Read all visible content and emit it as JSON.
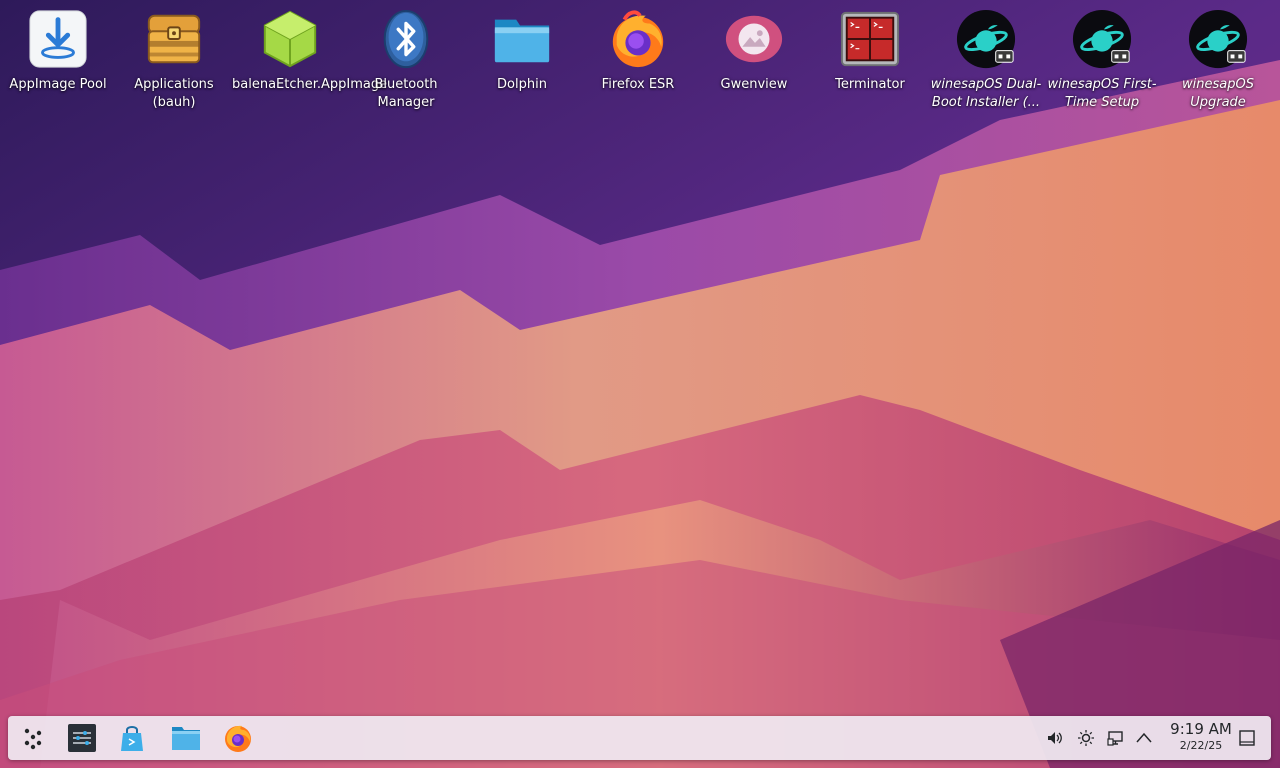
{
  "desktop": {
    "icons": [
      {
        "label": "AppImage Pool",
        "icon": "appimage-pool-icon"
      },
      {
        "label": "Applications (bauh)",
        "icon": "bauh-chest-icon"
      },
      {
        "label": "balenaEtcher.AppImage",
        "icon": "balena-etcher-icon"
      },
      {
        "label": "Bluetooth Manager",
        "icon": "bluetooth-icon"
      },
      {
        "label": "Dolphin",
        "icon": "folder-icon"
      },
      {
        "label": "Firefox ESR",
        "icon": "firefox-icon"
      },
      {
        "label": "Gwenview",
        "icon": "gwenview-icon"
      },
      {
        "label": "Terminator",
        "icon": "terminator-icon"
      },
      {
        "label": "winesapOS Dual-Boot Installer (...",
        "icon": "winesapos-icon"
      },
      {
        "label": "winesapOS First-Time Setup",
        "icon": "winesapos-icon"
      },
      {
        "label": "winesapOS Upgrade",
        "icon": "winesapos-icon"
      }
    ]
  },
  "taskbar": {
    "launchers": [
      "application-launcher-icon",
      "system-settings-icon",
      "discover-store-icon",
      "dolphin-folder-icon",
      "firefox-icon"
    ],
    "tray": [
      "volume-icon",
      "brightness-icon",
      "network-icon",
      "chevron-up-icon"
    ],
    "clock": {
      "time": "9:19 AM",
      "date": "2/22/25"
    },
    "show_desktop": "show-desktop-icon"
  },
  "colors": {
    "panel_bg": "#efe8f0",
    "accent_blue": "#3daee9",
    "text_light": "#ffffff",
    "text_dark": "#232629"
  }
}
